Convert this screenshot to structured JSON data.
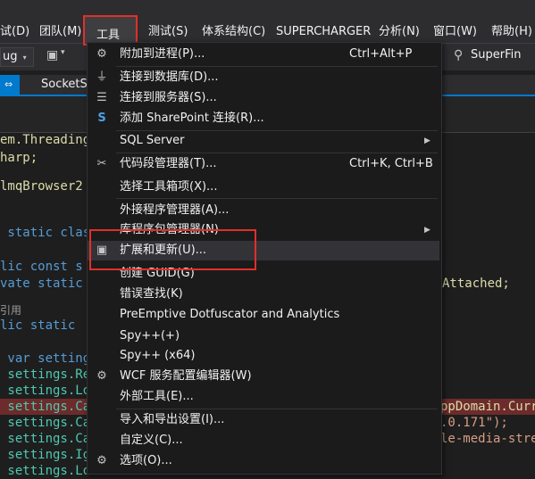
{
  "menubar": {
    "items": [
      "试(D)",
      "团队(M)",
      "工具(T)",
      "测试(S)",
      "体系结构(C)",
      "SUPERCHARGER",
      "分析(N)",
      "窗口(W)",
      "帮助(H)"
    ]
  },
  "toolbar": {
    "config_value": "ug",
    "search_label": "SuperFin"
  },
  "tabs": {
    "active_label": "⇔",
    "inactive_label": "SocketSe"
  },
  "editor": {
    "lines": [
      "em.Threading.",
      "harp;",
      "",
      "lmqBrowser2",
      "",
      " static clas",
      "",
      "lic const s",
      "vate static",
      "",
      "引用",
      "lic static",
      "",
      " var setting",
      " settings.Re",
      " settings.Lo",
      " settings.Ca",
      " settings.Ca",
      " settings.Ca",
      " settings.Ig",
      " settings.Lo"
    ],
    "right_fragments": {
      "attached": "Attached;",
      "appdomain": "ppDomain.Curr",
      "version": ".0.171\");",
      "media": "le-media-stre"
    }
  },
  "tools_menu": {
    "title": "工具(T)",
    "items": [
      {
        "icon": "attach-process-icon",
        "label": "附加到进程(P)...",
        "shortcut": "Ctrl+Alt+P",
        "submenu": false
      },
      {
        "icon": "connect-database-icon",
        "label": "连接到数据库(D)...",
        "shortcut": "",
        "submenu": false
      },
      {
        "icon": "connect-server-icon",
        "label": "连接到服务器(S)...",
        "shortcut": "",
        "submenu": false
      },
      {
        "icon": "sharepoint-icon",
        "label": "添加 SharePoint 连接(R)...",
        "shortcut": "",
        "submenu": false
      },
      {
        "icon": "",
        "label": "SQL Server",
        "shortcut": "",
        "submenu": true
      },
      {
        "icon": "code-snippet-icon",
        "label": "代码段管理器(T)...",
        "shortcut": "Ctrl+K, Ctrl+B",
        "submenu": false
      },
      {
        "icon": "",
        "label": "选择工具箱项(X)...",
        "shortcut": "",
        "submenu": false
      },
      {
        "icon": "",
        "label": "外接程序管理器(A)...",
        "shortcut": "",
        "submenu": false
      },
      {
        "icon": "",
        "label": "库程序包管理器(N)",
        "shortcut": "",
        "submenu": true
      },
      {
        "icon": "extensions-icon",
        "label": "扩展和更新(U)...",
        "shortcut": "",
        "submenu": false
      },
      {
        "icon": "",
        "label": "创建 GUID(G)",
        "shortcut": "",
        "submenu": false
      },
      {
        "icon": "",
        "label": "错误查找(K)",
        "shortcut": "",
        "submenu": false
      },
      {
        "icon": "",
        "label": "PreEmptive Dotfuscator and Analytics",
        "shortcut": "",
        "submenu": false
      },
      {
        "icon": "",
        "label": "Spy++(+)",
        "shortcut": "",
        "submenu": false
      },
      {
        "icon": "",
        "label": "Spy++ (x64)",
        "shortcut": "",
        "submenu": false
      },
      {
        "icon": "wcf-config-icon",
        "label": "WCF 服务配置编辑器(W)",
        "shortcut": "",
        "submenu": false
      },
      {
        "icon": "",
        "label": "外部工具(E)...",
        "shortcut": "",
        "submenu": false
      },
      {
        "icon": "",
        "label": "导入和导出设置(I)...",
        "shortcut": "",
        "submenu": false
      },
      {
        "icon": "",
        "label": "自定义(C)...",
        "shortcut": "",
        "submenu": false
      },
      {
        "icon": "gear-icon",
        "label": "选项(O)...",
        "shortcut": "",
        "submenu": false
      }
    ]
  },
  "colors": {
    "accent": "#007acc",
    "highlight_border": "#e0302a",
    "menu_bg": "#1b1b1c",
    "menubar_bg": "#2d2d30"
  }
}
